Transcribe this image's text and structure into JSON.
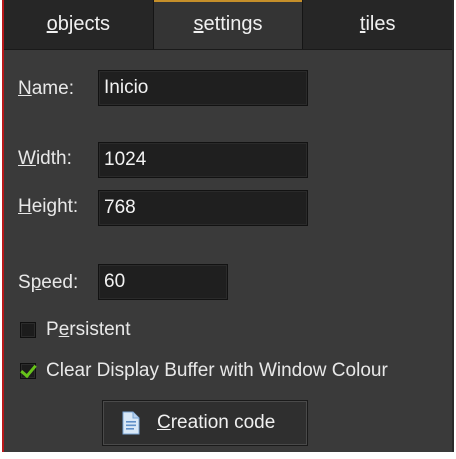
{
  "tabs": [
    {
      "pre": "",
      "u": "o",
      "post": "bjects",
      "active": false
    },
    {
      "pre": "",
      "u": "s",
      "post": "ettings",
      "active": true
    },
    {
      "pre": "",
      "u": "t",
      "post": "iles",
      "active": false
    }
  ],
  "fields": {
    "name": {
      "label_u": "N",
      "label_rest": "ame:",
      "value": "Inicio"
    },
    "width": {
      "label_u": "W",
      "label_rest": "idth:",
      "value": "1024"
    },
    "height": {
      "label_u": "H",
      "label_rest": "eight:",
      "value": "768"
    },
    "speed": {
      "label_pre": "S",
      "label_u": "p",
      "label_rest": "eed:",
      "value": "60"
    }
  },
  "checkboxes": {
    "persistent": {
      "pre": "P",
      "u": "e",
      "post": "rsistent",
      "checked": false
    },
    "clear_display": {
      "pre": "",
      "u": "",
      "post": "Clear Display Buffer with Window Colour",
      "checked": true
    }
  },
  "button": {
    "pre": "",
    "u": "C",
    "post": "reation code",
    "icon": "document-icon"
  },
  "colors": {
    "panel_bg": "#3a3a3a",
    "field_bg": "#1f1f1f",
    "accent_tab": "#c58f2a",
    "check_green": "#66c21a"
  }
}
